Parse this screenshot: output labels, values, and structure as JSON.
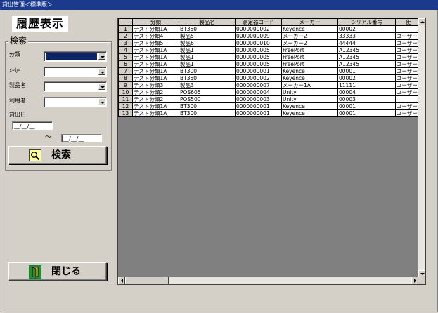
{
  "window": {
    "title": "貸出管理＜標準版＞"
  },
  "heading": "履歴表示",
  "search": {
    "group_label": "検索",
    "fields": {
      "category": {
        "label": "分類",
        "value": ""
      },
      "maker": {
        "label": "ﾒｰｶｰ",
        "value": ""
      },
      "product": {
        "label": "製品名",
        "value": ""
      },
      "user": {
        "label": "利用者",
        "value": ""
      }
    },
    "date_label": "貸出日",
    "date_from": "__/__/__",
    "date_to": "__/__/__",
    "range_sep": "～",
    "search_button": "検索"
  },
  "close_button": "閉じる",
  "grid": {
    "columns": [
      "",
      "分類",
      "製品名",
      "測定器コード",
      "メーカー",
      "シリアル番号",
      "使"
    ],
    "rows": [
      [
        "1",
        "テスト分類1A",
        "BT350",
        "0000000002",
        "Keyence",
        "00002",
        ""
      ],
      [
        "2",
        "テスト分類4",
        "製品5",
        "0000000009",
        "メーカー2",
        "33333",
        "ユーザー"
      ],
      [
        "3",
        "テスト分類5",
        "製品6",
        "0000000010",
        "メーカー2",
        "44444",
        "ユーザー"
      ],
      [
        "4",
        "テスト分類1A",
        "製品1",
        "0000000005",
        "FreePort",
        "A12345",
        "ユーザー"
      ],
      [
        "5",
        "テスト分類1A",
        "製品1",
        "0000000005",
        "FreePort",
        "A12345",
        "ユーザー"
      ],
      [
        "6",
        "テスト分類1A",
        "製品1",
        "0000000005",
        "FreePort",
        "A12345",
        "ユーザー"
      ],
      [
        "7",
        "テスト分類1A",
        "BT300",
        "0000000001",
        "Keyence",
        "00001",
        "ユーザー"
      ],
      [
        "8",
        "テスト分類1A",
        "BT350",
        "0000000002",
        "Keyence",
        "00002",
        "ユーザー"
      ],
      [
        "9",
        "テスト分類3",
        "製品3",
        "0000000007",
        "メーカー1A",
        "11111",
        "ユーザー"
      ],
      [
        "10",
        "テスト分類2",
        "POS605",
        "0000000004",
        "Unity",
        "00004",
        "ユーザー"
      ],
      [
        "11",
        "テスト分類2",
        "POS500",
        "0000000003",
        "Unity",
        "00003",
        ""
      ],
      [
        "12",
        "テスト分類1A",
        "BT300",
        "0000000001",
        "Keyence",
        "00001",
        "ユーザー"
      ],
      [
        "13",
        "テスト分類1A",
        "BT300",
        "0000000001",
        "Keyence",
        "00001",
        "ユーザー"
      ]
    ]
  },
  "colors": {
    "titlebar": "#1b3a8c",
    "selection": "#0a246a",
    "face": "#d4d0c8",
    "grid_bg": "#808080"
  }
}
